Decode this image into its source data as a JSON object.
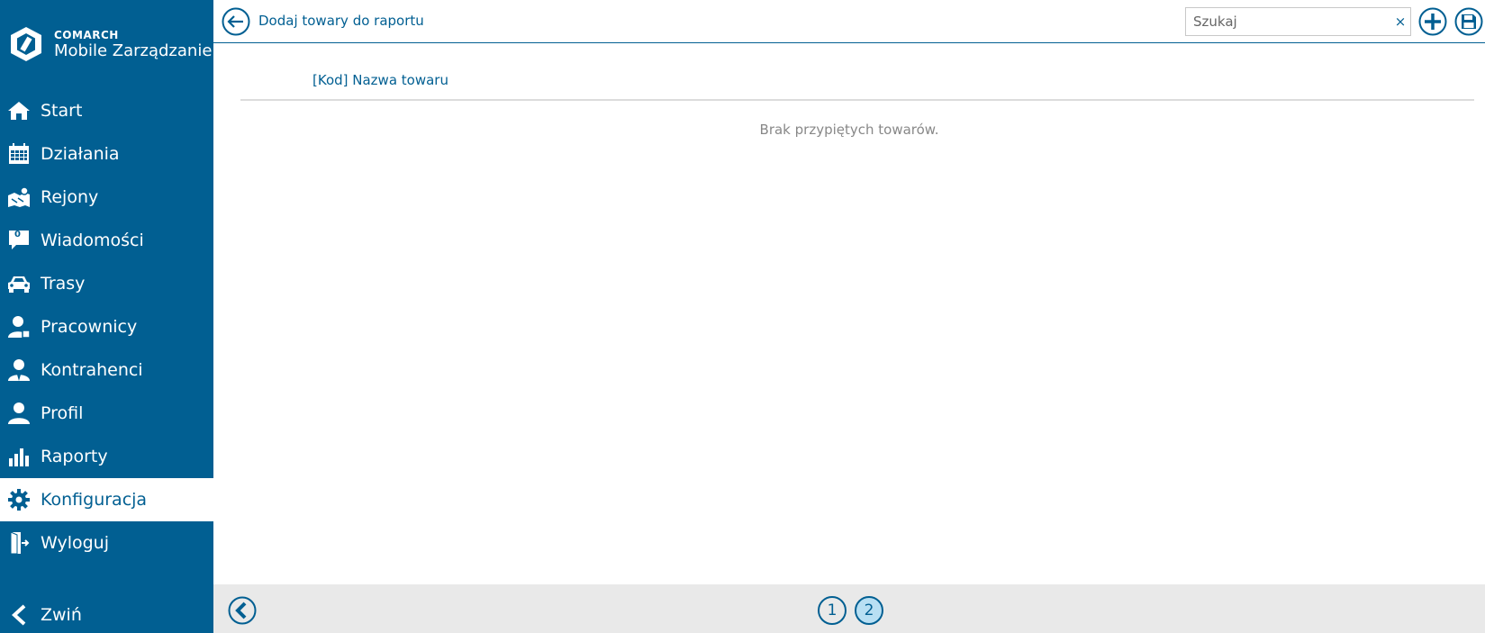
{
  "brand": {
    "company": "COMARCH",
    "product": "Mobile Zarządzanie"
  },
  "sidebar": {
    "items": [
      {
        "label": "Start",
        "icon": "home-icon"
      },
      {
        "label": "Działania",
        "icon": "calendar-icon"
      },
      {
        "label": "Rejony",
        "icon": "map-icon"
      },
      {
        "label": "Wiadomości",
        "icon": "message-icon",
        "badge": "0"
      },
      {
        "label": "Trasy",
        "icon": "car-icon"
      },
      {
        "label": "Pracownicy",
        "icon": "employee-icon"
      },
      {
        "label": "Kontrahenci",
        "icon": "contractor-icon"
      },
      {
        "label": "Profil",
        "icon": "user-icon"
      },
      {
        "label": "Raporty",
        "icon": "bar-chart-icon"
      },
      {
        "label": "Konfiguracja",
        "icon": "gear-icon",
        "active": true
      },
      {
        "label": "Wyloguj",
        "icon": "logout-icon"
      }
    ],
    "collapse_label": "Zwiń"
  },
  "header": {
    "title": "Dodaj towary do raportu",
    "search_placeholder": "Szukaj",
    "search_clear": "×"
  },
  "table": {
    "column_name": "[Kod] Nazwa towaru",
    "empty_message": "Brak przypiętych towarów."
  },
  "pagination": {
    "pages": [
      "1",
      "2"
    ],
    "current": "2"
  },
  "colors": {
    "primary": "#015f92",
    "footer_bg": "#e9e9e9",
    "active_page": "#b8dff3"
  }
}
